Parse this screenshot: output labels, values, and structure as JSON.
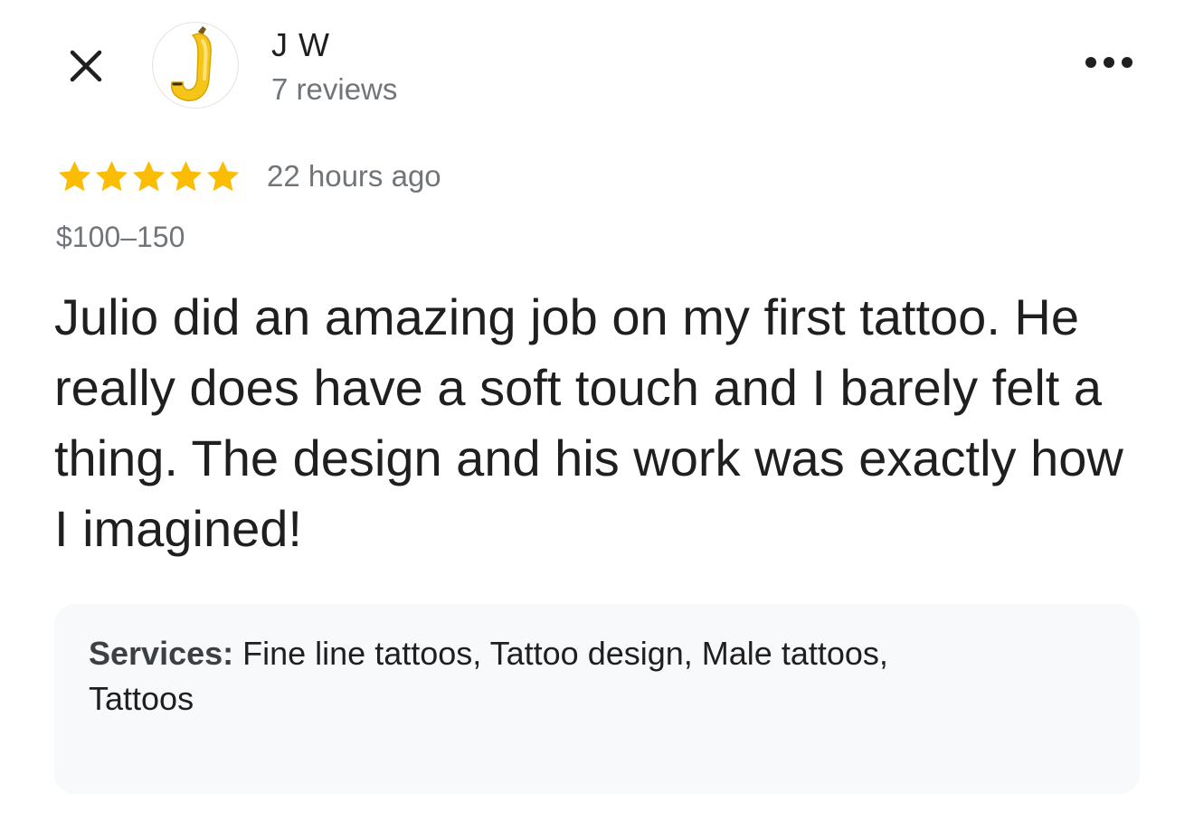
{
  "header": {
    "close_icon": "close-icon",
    "avatar": {
      "letter": "J",
      "icon": "banana-letter-j-avatar"
    },
    "author_name": "J W",
    "review_count": "7 reviews",
    "more_icon": "more-horizontal-icon"
  },
  "review": {
    "rating": 5,
    "rating_max": 5,
    "star_color": "#fbbc04",
    "time_ago": "22 hours ago",
    "price": "$100–150",
    "text": "Julio did an amazing job on my first tattoo. He really does have a soft touch and I barely felt a thing. The design and his work was exactly how I imagined!"
  },
  "services": {
    "label": "Services:",
    "value": " Fine line tattoos, Tattoo design, Male tattoos, Tattoos"
  }
}
